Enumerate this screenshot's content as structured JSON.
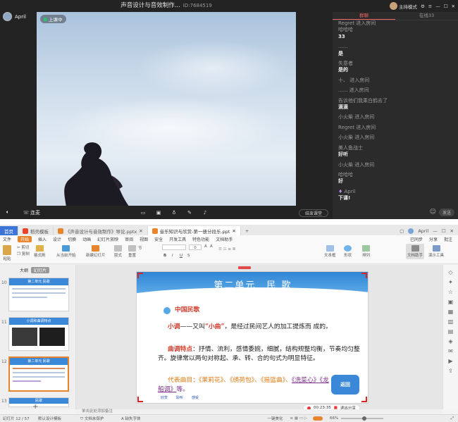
{
  "live": {
    "title": "声音设计与音效制作...",
    "room_id": "ID:7684519",
    "host_label": "主持模式",
    "user_name": "April",
    "live_badge": "上课中",
    "controls": {
      "mic_label": "连麦",
      "end_label": "结束课堂"
    },
    "chat": {
      "tabs": [
        "群聊",
        "在线33"
      ],
      "messages": [
        {
          "kind": "sys",
          "text": "Regret  进入房间"
        },
        {
          "kind": "msg",
          "name": "哈哈哈",
          "text": "33"
        },
        {
          "kind": "msg",
          "name": "......",
          "text": "是"
        },
        {
          "kind": "msg",
          "name": "失意者",
          "text": "是的"
        },
        {
          "kind": "sys",
          "text": "十、 进入房间"
        },
        {
          "kind": "sys",
          "text": "...... 进入房间"
        },
        {
          "kind": "msg",
          "name": "告诉他们我乘白鹤去了",
          "text": "滴滴"
        },
        {
          "kind": "sys",
          "text": "小火柴 进入房间"
        },
        {
          "kind": "sys",
          "text": "Regret  进入房间"
        },
        {
          "kind": "sys",
          "text": "小火柴 进入房间"
        },
        {
          "kind": "msg",
          "name": "美人鱼战士",
          "text": "好听"
        },
        {
          "kind": "sys",
          "text": "小火柴 进入房间"
        },
        {
          "kind": "msg",
          "name": "哈哈哈",
          "text": "好"
        },
        {
          "kind": "msg",
          "name": "April",
          "text": "下课!"
        }
      ],
      "send_label": "发送"
    }
  },
  "wps": {
    "tabs": [
      {
        "label": "首页",
        "kind": "home"
      },
      {
        "label": "稻壳模板",
        "kind": "normal"
      },
      {
        "label": "《声音设计与音效制作》导论.pptx",
        "kind": "normal"
      },
      {
        "label": "音乐知识与欣赏-第一册分段乐.ppt",
        "kind": "active"
      }
    ],
    "user": "April",
    "menu": [
      "文件",
      "开始",
      "插入",
      "设计",
      "切换",
      "动画",
      "幻灯片放映",
      "审阅",
      "视图",
      "安全",
      "开发工具",
      "特色功能",
      "文档助手"
    ],
    "menu_right": [
      "已同步",
      "分享",
      "批注"
    ],
    "ribbon": [
      "剪切",
      "复制",
      "格式刷",
      "从当前开始",
      "新建幻灯片",
      "版式",
      "节",
      "重置",
      "文本框",
      "形状",
      "排列",
      "文档助手",
      "演示工具"
    ],
    "ribbon_small": [
      "粘贴",
      "0",
      "A",
      "A"
    ],
    "left_tabs": [
      "大纲",
      "幻灯片"
    ],
    "thumbs": [
      {
        "num": "10",
        "caption": "第二单元 民歌"
      },
      {
        "num": "11",
        "caption": "小调和曲调特点"
      },
      {
        "num": "12",
        "caption": "第二单元 民歌"
      },
      {
        "num": "13",
        "caption": "民歌"
      }
    ],
    "slide": {
      "title": "第二单元　民  歌",
      "heading": "中国民歌",
      "p1_term": "小调",
      "p1_text": "——又叫",
      "p1_quote": "“小曲”",
      "p1_rest": "，是经过民间艺人的加工提炼而 成的。",
      "p2_term": "曲调特点",
      "p2_text": "：抒情、流利，感情委婉，细腻，结构规整均衡，节奏均匀整齐。旋律常以两句对称起、承、转、合的句式为明显特征。",
      "p3_term": "代表曲目",
      "p3_text": "：《茉莉花》、《绣荷包》、《摇篮曲》、",
      "p3_more": "《洗菜心》《龙船调》",
      "p3_end": "等。",
      "back_label": "返回",
      "footer_words": [
        "欣赏",
        "聆听",
        "感受"
      ]
    },
    "recording": {
      "time": "00:23:35",
      "exit_label": "退出分享"
    },
    "notes_placeholder": "单击此处添加备注",
    "status": {
      "slide_index": "幻灯片 12 / 57",
      "theme": "默认设计模板",
      "doc_protect": "文档未保护",
      "font_missing": "缺失字体",
      "beautify": "一键美化",
      "zoom": "66%"
    }
  }
}
